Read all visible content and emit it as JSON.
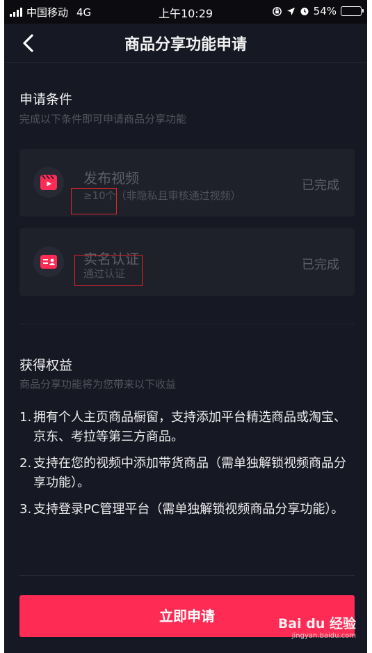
{
  "status_bar": {
    "carrier": "中国移动",
    "network": "4G",
    "time": "上午10:29",
    "battery": "54%",
    "battery_level": 0.54
  },
  "nav": {
    "title": "商品分享功能申请"
  },
  "conditions": {
    "title": "申请条件",
    "subtitle": "完成以下条件即可申请商品分享功能",
    "items": [
      {
        "title": "发布视频",
        "sub_highlight": "≥10个",
        "sub_rest": "（非隐私且审核通过视频）",
        "status": "已完成",
        "icon": "video-icon"
      },
      {
        "title": "实名认证",
        "sub_highlight": "通过认证",
        "sub_rest": "",
        "status": "已完成",
        "icon": "id-card-icon"
      }
    ]
  },
  "benefits": {
    "title": "获得权益",
    "subtitle": "商品分享功能将为您带来以下收益",
    "items": [
      {
        "num": "1.",
        "text": "拥有个人主页商品橱窗，支持添加平台精选商品或淘宝、京东、考拉等第三方商品。"
      },
      {
        "num": "2.",
        "text": "支持在您的视频中添加带货商品（需单独解锁视频商品分享功能）。"
      },
      {
        "num": "3.",
        "text": "支持登录PC管理平台（需单独解锁视频商品分享功能）。"
      }
    ]
  },
  "apply_button": "立即申请",
  "watermark": {
    "main": "Bai du 经验",
    "sub": "jingyan.baidu.com"
  },
  "colors": {
    "background": "#161823",
    "accent": "#fe2c55",
    "annotation": "#e0252e"
  }
}
